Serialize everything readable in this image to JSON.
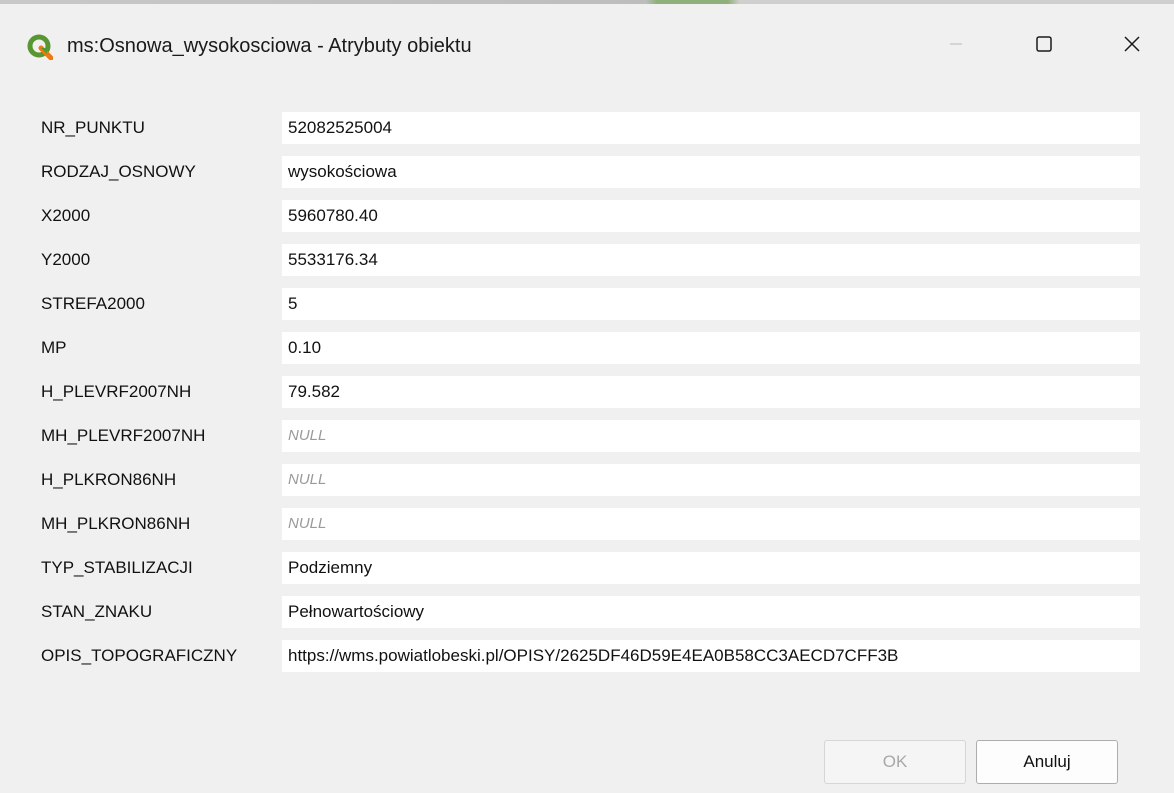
{
  "window": {
    "title": "ms:Osnowa_wysokosciowa - Atrybuty obiektu",
    "app_icon": "qgis-icon",
    "controls": {
      "minimize_icon": "minimize-icon",
      "maximize_icon": "maximize-icon",
      "close_icon": "close-icon"
    }
  },
  "attributes": [
    {
      "label": "NR_PUNKTU",
      "value": "52082525004",
      "is_null": false
    },
    {
      "label": "RODZAJ_OSNOWY",
      "value": "wysokościowa",
      "is_null": false
    },
    {
      "label": "X2000",
      "value": "5960780.40",
      "is_null": false
    },
    {
      "label": "Y2000",
      "value": "5533176.34",
      "is_null": false
    },
    {
      "label": "STREFA2000",
      "value": "5",
      "is_null": false
    },
    {
      "label": "MP",
      "value": "0.10",
      "is_null": false
    },
    {
      "label": "H_PLEVRF2007NH",
      "value": "79.582",
      "is_null": false
    },
    {
      "label": "MH_PLEVRF2007NH",
      "value": "NULL",
      "is_null": true
    },
    {
      "label": "H_PLKRON86NH",
      "value": "NULL",
      "is_null": true
    },
    {
      "label": "MH_PLKRON86NH",
      "value": "NULL",
      "is_null": true
    },
    {
      "label": "TYP_STABILIZACJI",
      "value": "Podziemny",
      "is_null": false
    },
    {
      "label": "STAN_ZNAKU",
      "value": "Pełnowartościowy",
      "is_null": false
    },
    {
      "label": "OPIS_TOPOGRAFICZNY",
      "value": "https://wms.powiatlobeski.pl/OPISY/2625DF46D59E4EA0B58CC3AECD7CFF3B",
      "is_null": false
    }
  ],
  "buttons": {
    "ok_label": "OK",
    "cancel_label": "Anuluj",
    "ok_enabled": false
  },
  "colors": {
    "qgis_green": "#589632",
    "qgis_yellow": "#ee7913",
    "window_bg": "#f0f0f0",
    "field_bg": "#ffffff",
    "null_text": "#9a9a9a"
  }
}
